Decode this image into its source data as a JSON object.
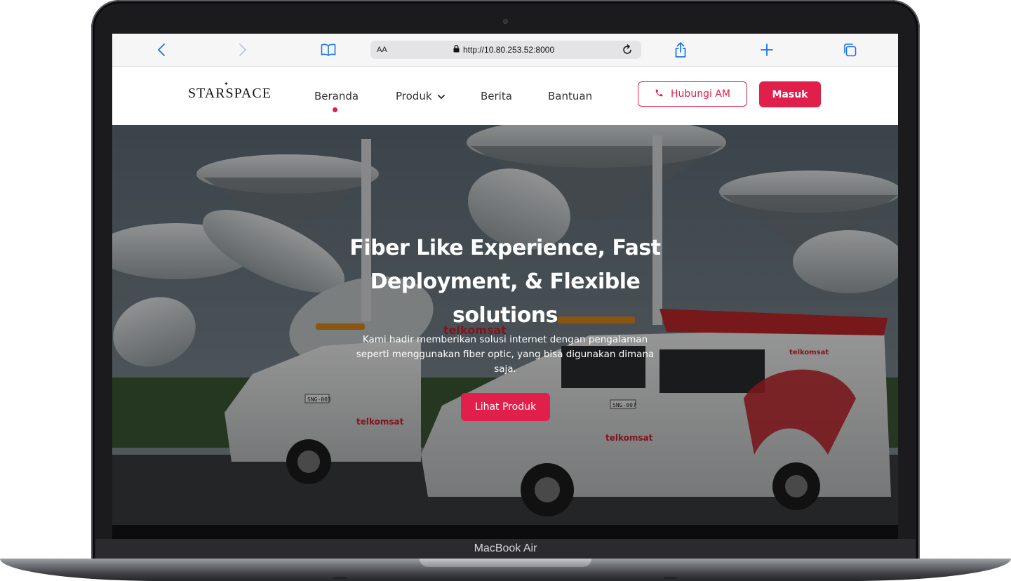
{
  "device": {
    "model_label": "MacBook Air"
  },
  "browser": {
    "text_size_label": "AA",
    "url": "http://10.80.253.52:8000",
    "icons": [
      "chevron-left-icon",
      "chevron-right-icon",
      "book-icon",
      "lock-icon",
      "reload-icon",
      "share-icon",
      "plus-icon",
      "tabs-icon"
    ]
  },
  "site": {
    "logo_text": "STARSPACE",
    "nav": {
      "home": "Beranda",
      "products": "Produk",
      "news": "Berita",
      "help": "Bantuan"
    },
    "contact_button": "Hubungi AM",
    "login_button": "Masuk",
    "accent_color": "#e0204b"
  },
  "hero": {
    "title": "Fiber Like Experience, Fast Deployment, & Flexible solutions",
    "subtitle": "Kami hadir memberikan solusi internet dengan pengalaman seperti menggunakan fiber optic, yang bisa digunakan dimana saja.",
    "cta": "Lihat Produk",
    "image_text": {
      "brand_1": "telkomsat",
      "brand_2": "telkomsat",
      "brand_3": "telkomsat",
      "brand_4": "telkomsat",
      "plate_1": "SNG-003",
      "plate_2": "SNG-007"
    }
  }
}
